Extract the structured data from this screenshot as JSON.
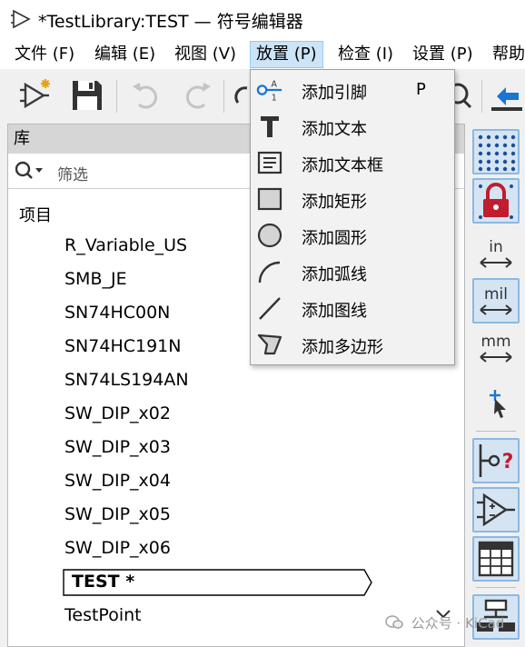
{
  "window": {
    "title": "*TestLibrary:TEST — 符号编辑器"
  },
  "menubar": [
    {
      "label": "文件 (F)"
    },
    {
      "label": "编辑 (E)"
    },
    {
      "label": "视图 (V)"
    },
    {
      "label": "放置 (P)",
      "active": true
    },
    {
      "label": "检查 (I)"
    },
    {
      "label": "设置 (P)"
    },
    {
      "label": "帮助"
    }
  ],
  "toolbar": [
    "new-symbol-icon",
    "save-icon",
    "undo-icon",
    "redo-icon",
    "refresh-icon",
    "zoom-icon",
    "paste-icon"
  ],
  "place_menu": {
    "items": [
      {
        "label": "添加引脚",
        "shortcut": "P",
        "icon": "pin-icon"
      },
      {
        "label": "添加文本",
        "icon": "text-icon"
      },
      {
        "label": "添加文本框",
        "icon": "textbox-icon"
      },
      {
        "label": "添加矩形",
        "icon": "rectangle-icon"
      },
      {
        "label": "添加圆形",
        "icon": "circle-icon"
      },
      {
        "label": "添加弧线",
        "icon": "arc-icon"
      },
      {
        "label": "添加图线",
        "icon": "line-icon"
      },
      {
        "label": "添加多边形",
        "icon": "polygon-icon"
      }
    ]
  },
  "library": {
    "header": "库",
    "filter_placeholder": "筛选",
    "tree_root": "项目",
    "items": [
      {
        "name": "R_Variable_US"
      },
      {
        "name": "SMB_JE"
      },
      {
        "name": "SN74HC00N"
      },
      {
        "name": "SN74HC191N"
      },
      {
        "name": "SN74LS194AN"
      },
      {
        "name": "SW_DIP_x02"
      },
      {
        "name": "SW_DIP_x03"
      },
      {
        "name": "SW_DIP_x04"
      },
      {
        "name": "SW_DIP_x05"
      },
      {
        "name": "SW_DIP_x06"
      },
      {
        "name": "TEST *",
        "selected": true
      },
      {
        "name": "TestPoint"
      }
    ]
  },
  "right_toolbar": {
    "unit_in": "in",
    "unit_mil": "mil",
    "unit_mm": "mm",
    "pin_check": "?"
  },
  "watermark": "公众号 · KiCad"
}
